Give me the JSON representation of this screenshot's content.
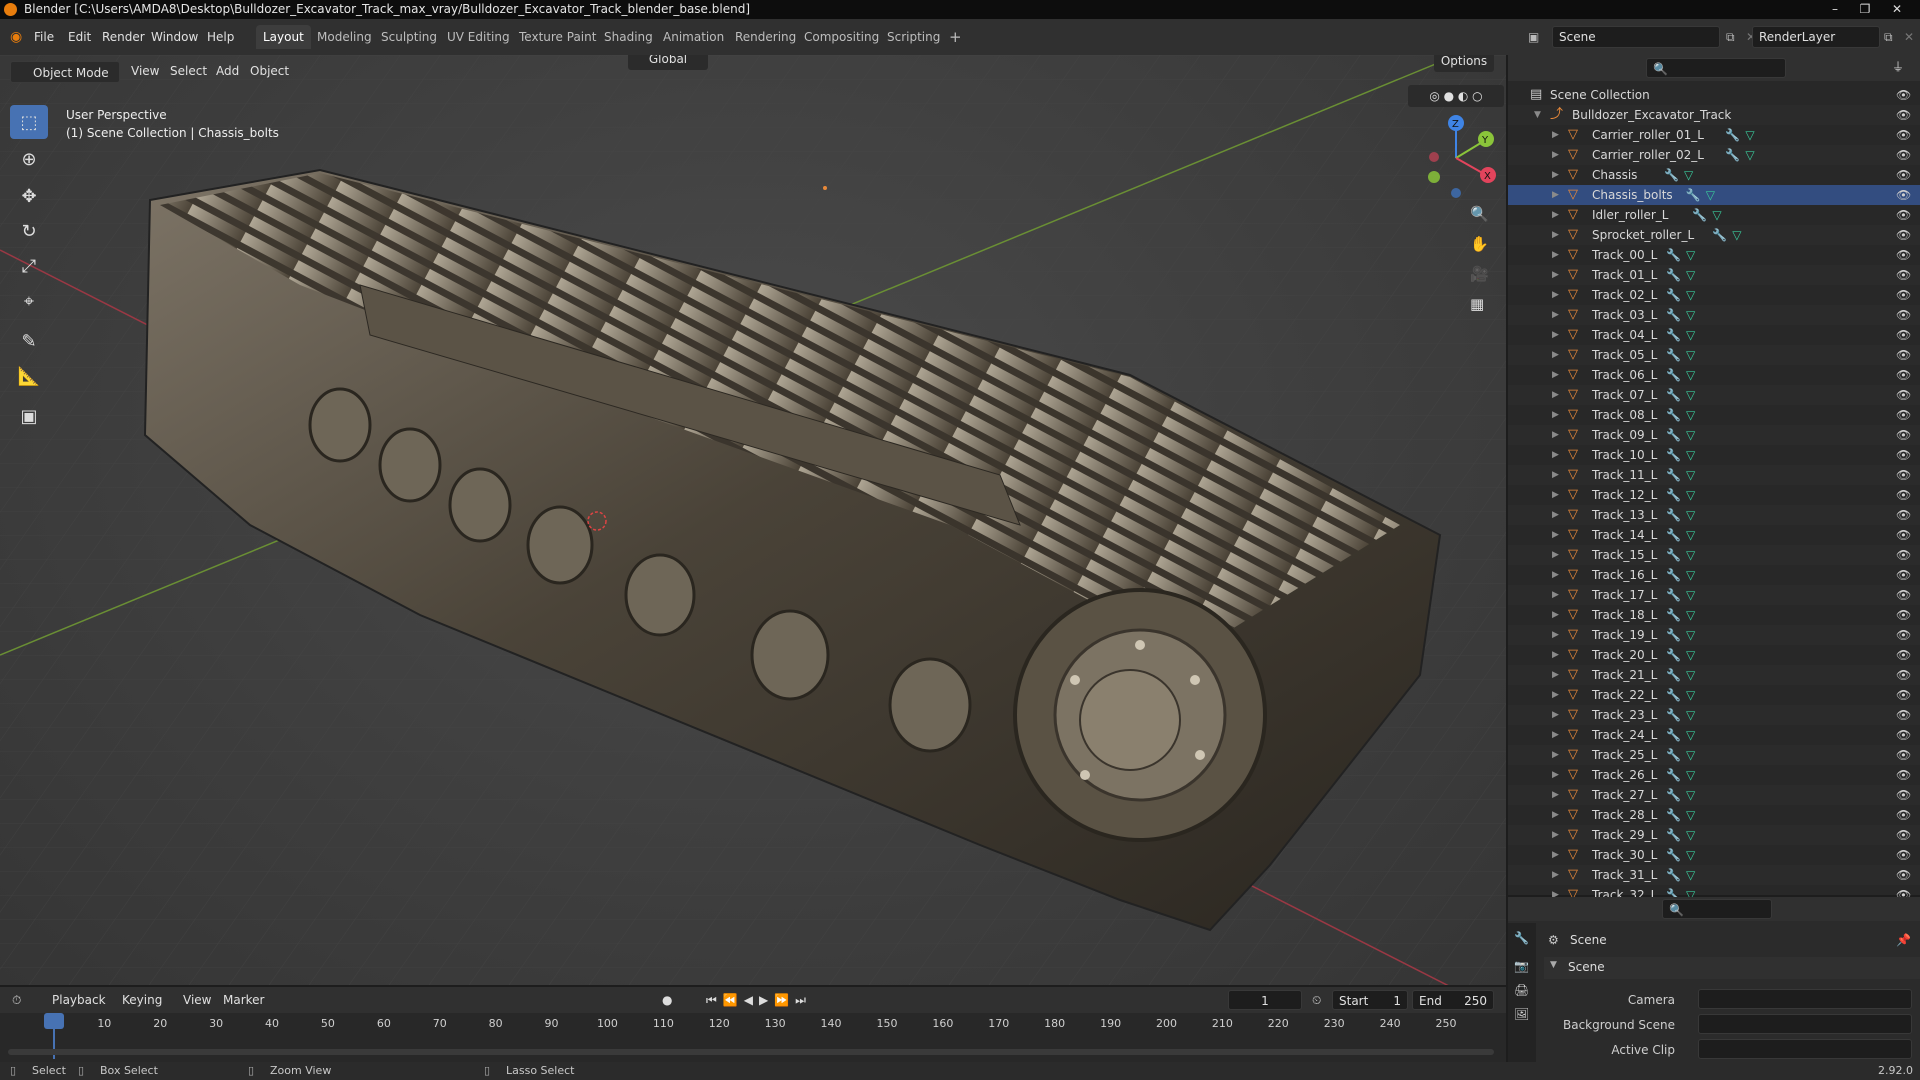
{
  "window": {
    "title": "Blender [C:\\Users\\AMDA8\\Desktop\\Bulldozer_Excavator_Track_max_vray/Bulldozer_Excavator_Track_blender_base.blend]"
  },
  "menus": [
    "File",
    "Edit",
    "Render",
    "Window",
    "Help"
  ],
  "workspaces": [
    "Layout",
    "Modeling",
    "Sculpting",
    "UV Editing",
    "Texture Paint",
    "Shading",
    "Animation",
    "Rendering",
    "Compositing",
    "Scripting"
  ],
  "active_workspace": "Layout",
  "scene_field": "Scene",
  "renderlayer_field": "RenderLayer",
  "viewport": {
    "mode": "Object Mode",
    "menus": [
      "View",
      "Select",
      "Add",
      "Object"
    ],
    "transform_orientation": "Global",
    "options_label": "Options",
    "overlay_line1": "User Perspective",
    "overlay_line2": "(1) Scene Collection | Chassis_bolts",
    "gizmo": {
      "x": "X",
      "y": "Y",
      "z": "Z"
    }
  },
  "outliner": {
    "root": "Scene Collection",
    "collection": "Bulldozer_Excavator_Track",
    "objects": [
      "Carrier_roller_01_L",
      "Carrier_roller_02_L",
      "Chassis",
      "Chassis_bolts",
      "Idler_roller_L",
      "Sprocket_roller_L",
      "Track_00_L",
      "Track_01_L",
      "Track_02_L",
      "Track_03_L",
      "Track_04_L",
      "Track_05_L",
      "Track_06_L",
      "Track_07_L",
      "Track_08_L",
      "Track_09_L",
      "Track_10_L",
      "Track_11_L",
      "Track_12_L",
      "Track_13_L",
      "Track_14_L",
      "Track_15_L",
      "Track_16_L",
      "Track_17_L",
      "Track_18_L",
      "Track_19_L",
      "Track_20_L",
      "Track_21_L",
      "Track_22_L",
      "Track_23_L",
      "Track_24_L",
      "Track_25_L",
      "Track_26_L",
      "Track_27_L",
      "Track_28_L",
      "Track_29_L",
      "Track_30_L",
      "Track_31_L",
      "Track_32_L"
    ],
    "selected_object": "Chassis_bolts"
  },
  "properties": {
    "context": "Scene",
    "panel": "Scene",
    "fields": [
      {
        "label": "Camera",
        "value": ""
      },
      {
        "label": "Background Scene",
        "value": ""
      },
      {
        "label": "Active Clip",
        "value": ""
      }
    ]
  },
  "timeline": {
    "menus": [
      "Playback",
      "Keying",
      "View",
      "Marker"
    ],
    "current_frame": "1",
    "start_label": "Start",
    "start": "1",
    "end_label": "End",
    "end": "250",
    "ticks": [
      "1",
      "10",
      "20",
      "30",
      "40",
      "50",
      "60",
      "70",
      "80",
      "90",
      "100",
      "110",
      "120",
      "130",
      "140",
      "150",
      "160",
      "170",
      "180",
      "190",
      "200",
      "210",
      "220",
      "230",
      "240",
      "250"
    ]
  },
  "statusbar": {
    "items": [
      "Select",
      "Box Select",
      "Zoom View",
      "Lasso Select"
    ],
    "version": "2.92.0"
  },
  "colors": {
    "accent": "#4772b3",
    "object_orange": "#e8893a",
    "modifier_blue": "#6a9fe0",
    "mesh_green": "#39c89b",
    "axis_x": "#e2445c",
    "axis_y": "#8ac43a",
    "axis_z": "#3f84e5"
  }
}
